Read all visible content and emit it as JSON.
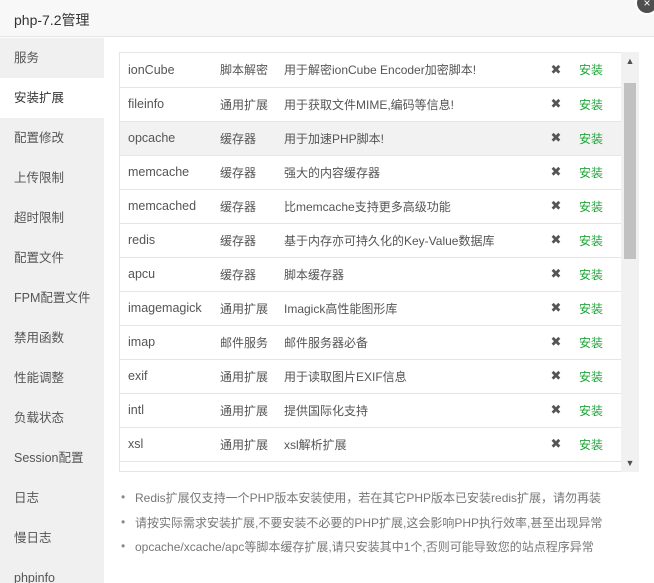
{
  "window": {
    "title": "php-7.2管理",
    "close_icon": "×"
  },
  "sidebar": {
    "items": [
      {
        "label": "服务",
        "active": false
      },
      {
        "label": "安装扩展",
        "active": true
      },
      {
        "label": "配置修改",
        "active": false
      },
      {
        "label": "上传限制",
        "active": false
      },
      {
        "label": "超时限制",
        "active": false
      },
      {
        "label": "配置文件",
        "active": false
      },
      {
        "label": "FPM配置文件",
        "active": false
      },
      {
        "label": "禁用函数",
        "active": false
      },
      {
        "label": "性能调整",
        "active": false
      },
      {
        "label": "负载状态",
        "active": false
      },
      {
        "label": "Session配置",
        "active": false
      },
      {
        "label": "日志",
        "active": false
      },
      {
        "label": "慢日志",
        "active": false
      },
      {
        "label": "phpinfo",
        "active": false
      }
    ]
  },
  "extensions": {
    "rows": [
      {
        "name": "ionCube",
        "type": "脚本解密",
        "desc": "用于解密ionCube Encoder加密脚本!",
        "status": "✖",
        "action": "安装"
      },
      {
        "name": "fileinfo",
        "type": "通用扩展",
        "desc": "用于获取文件MIME,编码等信息!",
        "status": "✖",
        "action": "安装"
      },
      {
        "name": "opcache",
        "type": "缓存器",
        "desc": "用于加速PHP脚本!",
        "status": "✖",
        "action": "安装"
      },
      {
        "name": "memcache",
        "type": "缓存器",
        "desc": "强大的内容缓存器",
        "status": "✖",
        "action": "安装"
      },
      {
        "name": "memcached",
        "type": "缓存器",
        "desc": "比memcache支持更多高级功能",
        "status": "✖",
        "action": "安装"
      },
      {
        "name": "redis",
        "type": "缓存器",
        "desc": "基于内存亦可持久化的Key-Value数据库",
        "status": "✖",
        "action": "安装"
      },
      {
        "name": "apcu",
        "type": "缓存器",
        "desc": "脚本缓存器",
        "status": "✖",
        "action": "安装"
      },
      {
        "name": "imagemagick",
        "type": "通用扩展",
        "desc": "Imagick高性能图形库",
        "status": "✖",
        "action": "安装"
      },
      {
        "name": "imap",
        "type": "邮件服务",
        "desc": "邮件服务器必备",
        "status": "✖",
        "action": "安装"
      },
      {
        "name": "exif",
        "type": "通用扩展",
        "desc": "用于读取图片EXIF信息",
        "status": "✖",
        "action": "安装"
      },
      {
        "name": "intl",
        "type": "通用扩展",
        "desc": "提供国际化支持",
        "status": "✖",
        "action": "安装"
      },
      {
        "name": "xsl",
        "type": "通用扩展",
        "desc": "xsl解析扩展",
        "status": "✖",
        "action": "安装"
      }
    ],
    "scroll_up_icon": "▲",
    "scroll_down_icon": "▼"
  },
  "tips": [
    "Redis扩展仅支持一个PHP版本安装使用，若在其它PHP版本已安装redis扩展，请勿再装",
    "请按实际需求安装扩展,不要安装不必要的PHP扩展,这会影响PHP执行效率,甚至出现异常",
    "opcache/xcache/apc等脚本缓存扩展,请只安装其中1个,否则可能导致您的站点程序异常"
  ],
  "tip_bullet": "•",
  "colors": {
    "install_action": "#20a53a",
    "highlight_row": "#f2f2f2",
    "sidebar_bg": "#f0f0f0"
  }
}
